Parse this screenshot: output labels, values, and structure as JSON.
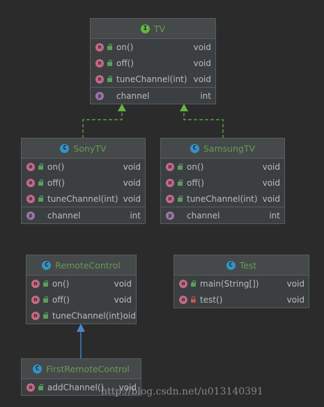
{
  "classes": {
    "tv": {
      "kind": "I",
      "name": "TV",
      "methods": [
        {
          "name": "on()",
          "type": "void"
        },
        {
          "name": "off()",
          "type": "void"
        },
        {
          "name": "tuneChannel(int)",
          "type": "void"
        }
      ],
      "fields": [
        {
          "name": "channel",
          "type": "int"
        }
      ]
    },
    "sony": {
      "kind": "C",
      "name": "SonyTV",
      "methods": [
        {
          "name": "on()",
          "type": "void"
        },
        {
          "name": "off()",
          "type": "void"
        },
        {
          "name": "tuneChannel(int)",
          "type": "void"
        }
      ],
      "fields": [
        {
          "name": "channel",
          "type": "int"
        }
      ]
    },
    "samsung": {
      "kind": "C",
      "name": "SamsungTV",
      "methods": [
        {
          "name": "on()",
          "type": "void"
        },
        {
          "name": "off()",
          "type": "void"
        },
        {
          "name": "tuneChannel(int)",
          "type": "void"
        }
      ],
      "fields": [
        {
          "name": "channel",
          "type": "int"
        }
      ]
    },
    "remote": {
      "kind": "C",
      "name": "RemoteControl",
      "methods": [
        {
          "name": "on()",
          "type": "void"
        },
        {
          "name": "off()",
          "type": "void"
        },
        {
          "name": "tuneChannel(int)",
          "type": "oid"
        }
      ]
    },
    "test": {
      "kind": "C",
      "name": "Test",
      "methods": [
        {
          "name": "main(String[])",
          "type": "void"
        },
        {
          "name": "test()",
          "type": "void"
        }
      ]
    },
    "firstremote": {
      "kind": "C",
      "name": "FirstRemoteControl",
      "methods": [
        {
          "name": "addChannel()",
          "type": "void"
        }
      ]
    }
  },
  "icons": {
    "method": "m",
    "field": "p"
  },
  "colors": {
    "background": "#2b2b2b",
    "realization_arrow": "#62b543",
    "inheritance_arrow": "#4a88c7",
    "class_name": "#6a9955"
  },
  "watermark": "http://blog.csdn.net/u013140391"
}
